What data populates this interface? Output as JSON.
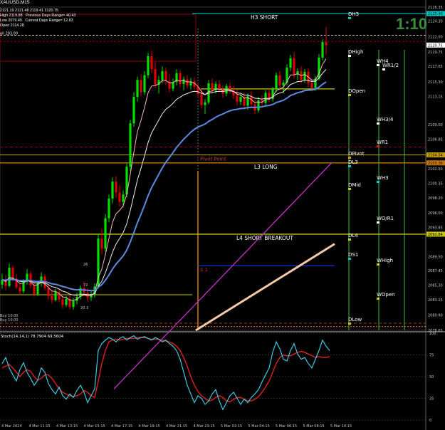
{
  "window": {
    "title": "XAUUSD,M15"
  },
  "info_lines": [
    "2121.19 2121.48 2119.41 2120.75",
    "High 2119.88   Previous Days Range= 40.43",
    "Low 2079.45   Current Days Range= 12.83",
    "Open 2114.28"
  ],
  "countdown": "1:10",
  "price_axis": [
    "2126.35",
    "2124.30",
    "2122.00",
    "2119.75",
    "2117.65",
    "2115.30",
    "2113.15",
    "2109.00",
    "2106.85",
    "2104.54",
    "2102.50",
    "2100.35",
    "2098.20",
    "2096.00",
    "2093.85",
    "2092.84",
    "2089.50",
    "2087.45",
    "2085.30",
    "2083.15",
    "2080.90",
    "2078.65"
  ],
  "price_tags": [
    {
      "label": "2125.40",
      "color": "#00c8c8"
    },
    {
      "label": "2120.75",
      "color": "#ffffff"
    },
    {
      "label": "2104.54",
      "color": "#c8a000"
    },
    {
      "label": "2103.36",
      "color": "#c87800"
    },
    {
      "label": "2092.84",
      "color": "#c8c800"
    }
  ],
  "levels": {
    "h3_short": "H3 SHORT",
    "l3_long": "L3 LONG",
    "l4_short_breakout": "L4 SHORT BREAKOUT",
    "pivot_point": "Pivot Point",
    "s1": "S 1",
    "small_labels": [
      "ull 293.00",
      "26",
      "72",
      "20.3",
      "Buy 10.00",
      "Buy 10.00"
    ]
  },
  "right_labels": [
    {
      "text": "DH3"
    },
    {
      "text": "DHigh"
    },
    {
      "text": "WH4"
    },
    {
      "text": "WR1/2"
    },
    {
      "text": "DOpen"
    },
    {
      "text": "WH3/4"
    },
    {
      "text": "WR1"
    },
    {
      "text": "DPivot"
    },
    {
      "text": "DL3"
    },
    {
      "text": "WH3"
    },
    {
      "text": "DMid"
    },
    {
      "text": "WO/R1"
    },
    {
      "text": "DL4"
    },
    {
      "text": "DS1"
    },
    {
      "text": "WHigh"
    },
    {
      "text": "WOpen"
    },
    {
      "text": "DLow"
    }
  ],
  "indicator": {
    "title": "Stoch(14,14,1) 78.7904 69.5604",
    "axis": [
      "100",
      "75",
      "50",
      "25",
      "0"
    ]
  },
  "time_axis": [
    "4 Mar 2024",
    "4 Mar 11:15",
    "4 Mar 13:15",
    "4 Mar 15:15",
    "4 Mar 17:15",
    "4 Mar 19:15",
    "4 Mar 21:15",
    "4 Mar 23:15",
    "5 Mar 02:15",
    "5 Mar 04:15",
    "5 Mar 06:15",
    "5 Mar 08:15",
    "5 Mar 10:15"
  ],
  "colors": {
    "bull": "#00e000",
    "bear": "#e00000",
    "ma_blue": "#5b8ae0",
    "ma_magenta": "#c830c8",
    "ma_white": "#f0f0f0",
    "ma_pink": "#f2b8b8",
    "stoch_main": "#40c8e0",
    "stoch_signal": "#d02020"
  },
  "chart_data": {
    "type": "line",
    "symbol": "XAUUSD",
    "timeframe": "M15",
    "ylim": [
      2078.65,
      2126.35
    ],
    "stoch_ylim": [
      0,
      100
    ],
    "candles": [
      [
        2085.4,
        2087.0,
        2084.8,
        2086.1
      ],
      [
        2086.1,
        2086.8,
        2084.6,
        2085.2
      ],
      [
        2085.2,
        2088.5,
        2085.0,
        2087.9
      ],
      [
        2087.9,
        2088.2,
        2085.9,
        2086.3
      ],
      [
        2086.3,
        2086.9,
        2084.7,
        2085.0
      ],
      [
        2085.0,
        2085.6,
        2083.9,
        2084.4
      ],
      [
        2084.4,
        2086.2,
        2084.1,
        2085.8
      ],
      [
        2085.8,
        2087.7,
        2085.4,
        2087.0
      ],
      [
        2087.0,
        2087.4,
        2084.9,
        2085.3
      ],
      [
        2085.3,
        2085.8,
        2083.6,
        2084.0
      ],
      [
        2084.0,
        2085.9,
        2083.7,
        2085.6
      ],
      [
        2085.6,
        2087.2,
        2085.1,
        2086.6
      ],
      [
        2086.6,
        2086.9,
        2084.5,
        2084.9
      ],
      [
        2084.9,
        2085.4,
        2083.2,
        2083.7
      ],
      [
        2083.7,
        2084.6,
        2082.6,
        2083.1
      ],
      [
        2083.1,
        2084.8,
        2082.9,
        2084.3
      ],
      [
        2084.3,
        2084.7,
        2082.8,
        2083.2
      ],
      [
        2083.2,
        2083.6,
        2081.9,
        2082.4
      ],
      [
        2082.4,
        2083.7,
        2082.1,
        2083.3
      ],
      [
        2083.3,
        2083.9,
        2081.8,
        2082.1
      ],
      [
        2082.1,
        2083.4,
        2081.7,
        2083.0
      ],
      [
        2083.0,
        2084.2,
        2082.5,
        2083.6
      ],
      [
        2083.6,
        2085.3,
        2083.2,
        2084.9
      ],
      [
        2084.9,
        2085.8,
        2083.8,
        2084.2
      ],
      [
        2084.2,
        2084.9,
        2082.9,
        2083.5
      ],
      [
        2083.5,
        2084.4,
        2083.0,
        2083.9
      ],
      [
        2083.9,
        2085.6,
        2083.5,
        2085.1
      ],
      [
        2085.1,
        2092.8,
        2084.8,
        2092.2
      ],
      [
        2092.2,
        2093.6,
        2089.9,
        2090.7
      ],
      [
        2090.7,
        2095.8,
        2090.3,
        2095.2
      ],
      [
        2095.2,
        2098.7,
        2094.6,
        2098.1
      ],
      [
        2098.1,
        2101.2,
        2097.4,
        2100.6
      ],
      [
        2100.6,
        2101.4,
        2098.2,
        2099.0
      ],
      [
        2099.0,
        2100.1,
        2096.9,
        2097.6
      ],
      [
        2097.6,
        2099.3,
        2096.8,
        2098.7
      ],
      [
        2098.7,
        2103.3,
        2098.3,
        2102.8
      ],
      [
        2102.8,
        2109.7,
        2102.2,
        2109.2
      ],
      [
        2109.2,
        2113.8,
        2108.7,
        2113.1
      ],
      [
        2113.1,
        2116.1,
        2112.4,
        2115.6
      ],
      [
        2115.6,
        2116.4,
        2113.2,
        2113.8
      ],
      [
        2113.8,
        2116.9,
        2113.4,
        2116.3
      ],
      [
        2116.3,
        2119.6,
        2115.9,
        2119.1
      ],
      [
        2119.1,
        2119.9,
        2116.6,
        2117.2
      ],
      [
        2117.2,
        2118.3,
        2114.4,
        2114.9
      ],
      [
        2114.9,
        2116.2,
        2113.6,
        2115.6
      ],
      [
        2115.6,
        2117.6,
        2115.1,
        2116.9
      ],
      [
        2116.9,
        2117.4,
        2114.9,
        2115.4
      ],
      [
        2115.4,
        2116.4,
        2113.8,
        2114.3
      ],
      [
        2114.3,
        2115.8,
        2113.9,
        2115.3
      ],
      [
        2115.3,
        2117.2,
        2114.8,
        2116.6
      ],
      [
        2116.6,
        2117.0,
        2114.6,
        2115.0
      ],
      [
        2115.0,
        2116.1,
        2114.1,
        2115.7
      ],
      [
        2115.7,
        2116.3,
        2114.4,
        2114.8
      ],
      [
        2114.8,
        2115.9,
        2114.2,
        2115.4
      ],
      [
        2115.4,
        2116.0,
        2114.1,
        2114.6
      ],
      [
        2114.6,
        2115.2,
        2113.0,
        2113.5
      ],
      [
        2113.5,
        2114.1,
        2111.4,
        2111.9
      ],
      [
        2111.9,
        2112.8,
        2110.6,
        2112.3
      ],
      [
        2112.3,
        2115.6,
        2112.0,
        2115.1
      ],
      [
        2115.1,
        2115.8,
        2113.7,
        2114.1
      ],
      [
        2114.1,
        2115.4,
        2113.6,
        2115.0
      ],
      [
        2115.0,
        2115.6,
        2113.8,
        2114.2
      ],
      [
        2114.2,
        2114.8,
        2113.0,
        2113.6
      ],
      [
        2113.6,
        2115.0,
        2113.2,
        2114.7
      ],
      [
        2114.7,
        2115.3,
        2113.6,
        2114.0
      ],
      [
        2114.0,
        2114.7,
        2112.8,
        2113.3
      ],
      [
        2113.3,
        2114.2,
        2111.8,
        2112.4
      ],
      [
        2112.4,
        2113.5,
        2111.9,
        2113.1
      ],
      [
        2113.1,
        2113.7,
        2111.3,
        2111.8
      ],
      [
        2111.8,
        2113.6,
        2111.2,
        2113.2
      ],
      [
        2113.2,
        2113.9,
        2111.5,
        2112.0
      ],
      [
        2112.0,
        2112.7,
        2110.6,
        2111.1
      ],
      [
        2111.1,
        2113.1,
        2110.8,
        2112.6
      ],
      [
        2112.6,
        2113.4,
        2111.8,
        2112.2
      ],
      [
        2112.2,
        2114.1,
        2111.9,
        2113.7
      ],
      [
        2113.7,
        2114.3,
        2112.3,
        2112.8
      ],
      [
        2112.8,
        2114.6,
        2112.4,
        2114.2
      ],
      [
        2114.2,
        2116.7,
        2113.8,
        2116.3
      ],
      [
        2116.3,
        2116.9,
        2114.3,
        2114.8
      ],
      [
        2114.8,
        2115.6,
        2113.6,
        2115.2
      ],
      [
        2115.2,
        2117.9,
        2114.8,
        2117.4
      ],
      [
        2117.4,
        2119.3,
        2116.9,
        2118.8
      ],
      [
        2118.8,
        2119.7,
        2115.8,
        2116.4
      ],
      [
        2116.4,
        2117.3,
        2115.6,
        2116.9
      ],
      [
        2116.9,
        2117.6,
        2115.1,
        2115.6
      ],
      [
        2115.6,
        2117.2,
        2115.2,
        2116.8
      ],
      [
        2116.8,
        2117.3,
        2114.6,
        2115.1
      ],
      [
        2115.1,
        2115.8,
        2113.9,
        2114.4
      ],
      [
        2114.4,
        2116.2,
        2114.0,
        2115.8
      ],
      [
        2115.8,
        2119.4,
        2115.5,
        2118.9
      ],
      [
        2118.9,
        2121.6,
        2118.5,
        2121.2
      ],
      [
        2121.2,
        2123.4,
        2119.3,
        2120.75
      ]
    ],
    "stoch_main": [
      65,
      72,
      60,
      52,
      45,
      58,
      66,
      55,
      48,
      40,
      46,
      60,
      55,
      42,
      35,
      30,
      38,
      28,
      24,
      30,
      26,
      34,
      40,
      32,
      20,
      28,
      36,
      80,
      88,
      92,
      95,
      93,
      90,
      94,
      96,
      92,
      95,
      97,
      93,
      95,
      96,
      94,
      92,
      95,
      93,
      90,
      92,
      88,
      85,
      80,
      70,
      55,
      40,
      30,
      20,
      28,
      25,
      18,
      22,
      30,
      35,
      22,
      12,
      20,
      28,
      32,
      25,
      18,
      24,
      20,
      26,
      30,
      35,
      44,
      52,
      60,
      78,
      90,
      82,
      70,
      68,
      80,
      88,
      76,
      70,
      72,
      65,
      60,
      70,
      80,
      92,
      85,
      80
    ],
    "stoch_signal": [
      60,
      62,
      64,
      60,
      55,
      50,
      55,
      58,
      56,
      50,
      46,
      48,
      52,
      52,
      48,
      42,
      36,
      32,
      30,
      28,
      27,
      28,
      30,
      34,
      32,
      28,
      26,
      45,
      65,
      80,
      90,
      92,
      93,
      92,
      93,
      94,
      94,
      94,
      95,
      95,
      95,
      94,
      93,
      93,
      93,
      92,
      91,
      90,
      88,
      85,
      80,
      72,
      62,
      50,
      40,
      33,
      28,
      25,
      22,
      23,
      26,
      28,
      26,
      22,
      21,
      24,
      26,
      26,
      24,
      22,
      22,
      24,
      27,
      32,
      38,
      45,
      55,
      65,
      72,
      75,
      74,
      74,
      76,
      78,
      79,
      78,
      76,
      74,
      72,
      73,
      72,
      72,
      73
    ]
  }
}
